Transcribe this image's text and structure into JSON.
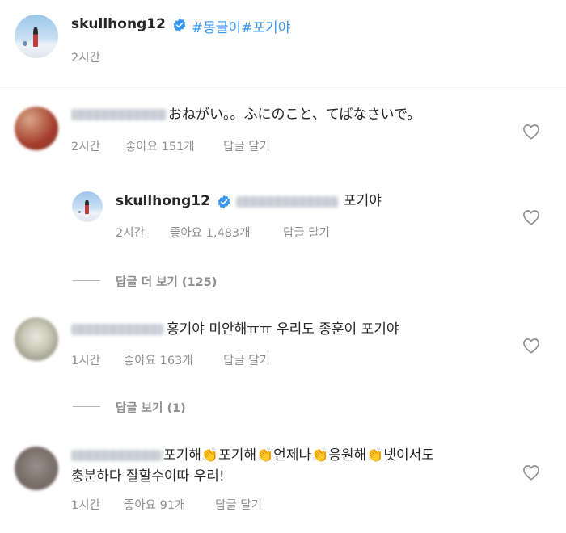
{
  "post": {
    "username": "skullhong12",
    "hashtags": "#몽글이#포기야",
    "time": "2시간"
  },
  "comments": [
    {
      "text": "おねがい。。ふにのこと、てばなさいで。",
      "time": "2시간",
      "likes": "좋아요 151개",
      "reply_label": "답글 달기",
      "reply": {
        "username": "skullhong12",
        "text": "포기야",
        "time": "2시간",
        "likes": "좋아요 1,483개",
        "reply_label": "답글 달기"
      },
      "view_replies": "답글 더 보기 (125)"
    },
    {
      "text": "홍기야 미안해ㅠㅠ 우리도 종훈이 포기야",
      "time": "1시간",
      "likes": "좋아요 163개",
      "reply_label": "답글 달기",
      "view_replies": "답글 보기 (1)"
    },
    {
      "text_line1": "포기해👏포기해👏언제나👏응원해👏넷이서도",
      "text_line2": "충분하다 잘할수이따 우리!",
      "time": "1시간",
      "likes": "좋아요 91개",
      "reply_label": "답글 달기"
    }
  ],
  "colors": {
    "verified": "#3897f0",
    "hashtag": "#3897f0",
    "meta": "#8e8e8e"
  }
}
